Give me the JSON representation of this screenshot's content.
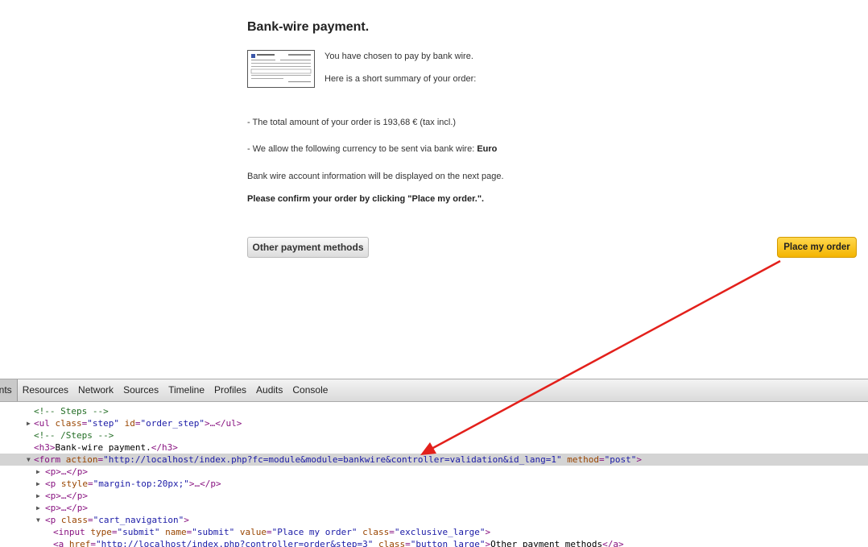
{
  "page": {
    "title": "Bank-wire payment.",
    "line1": "You have chosen to pay by bank wire.",
    "line2": "Here is a short summary of your order:",
    "total": "- The total amount of your order is 193,68 € (tax incl.)",
    "currency_prefix": "- We allow the following currency to be sent via bank wire: ",
    "currency": "Euro",
    "info": "Bank wire account information will be displayed on the next page.",
    "confirm": "Please confirm your order by clicking \"Place my order.\".",
    "btn_other": "Other payment methods",
    "btn_place": "Place my order"
  },
  "devtools": {
    "tabs": [
      "ents",
      "Resources",
      "Network",
      "Sources",
      "Timeline",
      "Profiles",
      "Audits",
      "Console"
    ],
    "dom": {
      "l0": "<!-- Steps -->",
      "l1_tag_open": "<ul ",
      "l1_a1": "class",
      "l1_v1": "\"step\"",
      "l1_a2": "id",
      "l1_v2": "\"order_step\"",
      "l1_rest": ">…</ul>",
      "l2": "<!-- /Steps -->",
      "l3_open": "<h3>",
      "l3_text": "Bank-wire payment.",
      "l3_close": "</h3>",
      "l4_open": "<form ",
      "l4_a1": "action",
      "l4_v1": "\"http://localhost/index.php?fc=module&module=bankwire&controller=validation&id_lang=1\"",
      "l4_a2": "method",
      "l4_v2": "\"post\"",
      "l4_close": ">",
      "l5": "<p>…</p>",
      "l6_open": "<p ",
      "l6_a1": "style",
      "l6_v1": "\"margin-top:20px;\"",
      "l6_rest": ">…</p>",
      "l7": "<p>…</p>",
      "l8": "<p>…</p>",
      "l9_open": "<p ",
      "l9_a1": "class",
      "l9_v1": "\"cart_navigation\"",
      "l9_close": ">",
      "l10_open": "<input ",
      "l10_a1": "type",
      "l10_v1": "\"submit\"",
      "l10_a2": "name",
      "l10_v2": "\"submit\"",
      "l10_a3": "value",
      "l10_v3": "\"Place my order\"",
      "l10_a4": "class",
      "l10_v4": "\"exclusive_large\"",
      "l10_close": ">",
      "l11_open": "<a ",
      "l11_a1": "href",
      "l11_v1": "\"http://localhost/index.php?controller=order&step=3\"",
      "l11_a2": "class",
      "l11_v2": "\"button_large\"",
      "l11_text": "Other payment methods",
      "l11_close": "</a>"
    }
  },
  "colors": {
    "arrow": "#e3201b",
    "place_button": "#f4b400"
  }
}
